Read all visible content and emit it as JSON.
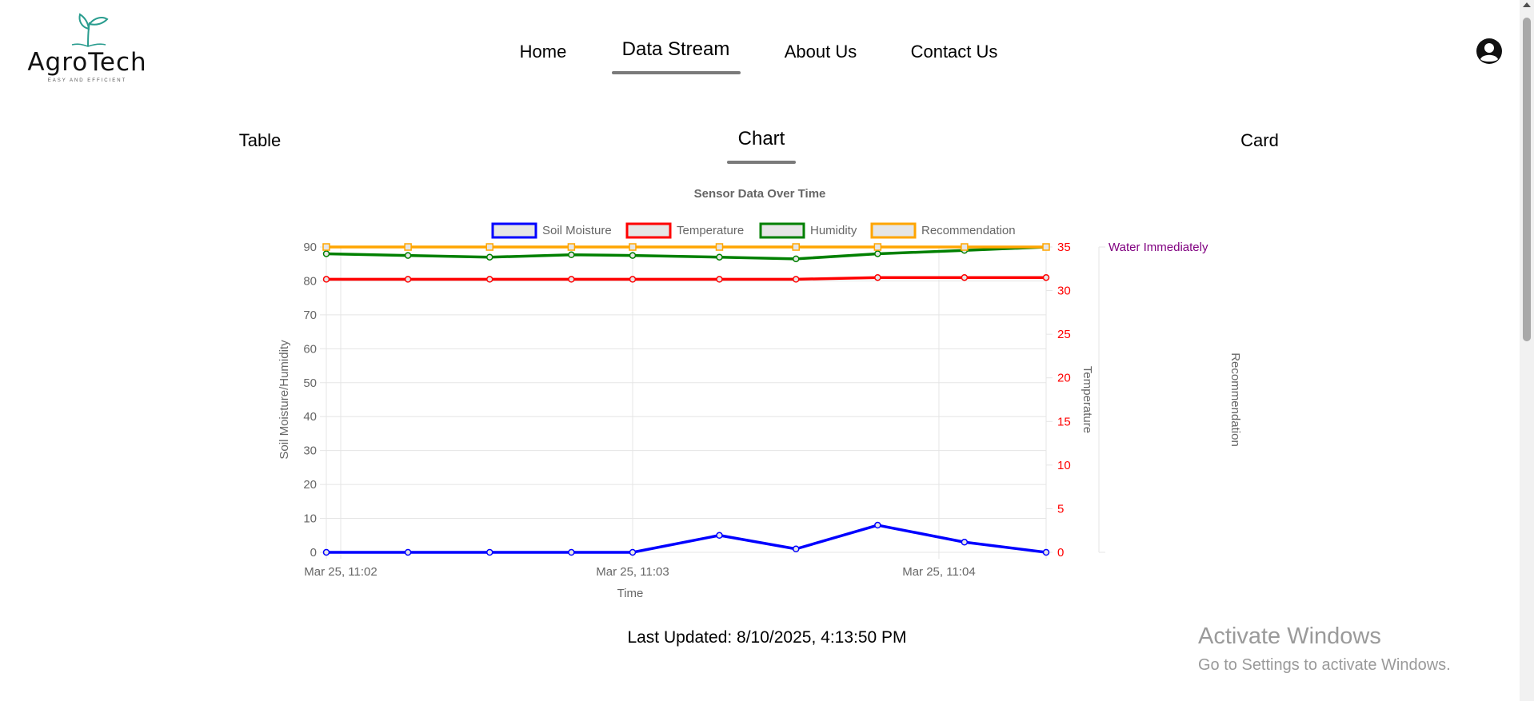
{
  "brand": {
    "name": "AgroTech",
    "tagline": "EASY AND EFFICIENT"
  },
  "nav": {
    "items": [
      {
        "label": "Home",
        "active": false
      },
      {
        "label": "Data Stream",
        "active": true
      },
      {
        "label": "About Us",
        "active": false
      },
      {
        "label": "Contact Us",
        "active": false
      }
    ]
  },
  "user": {
    "icon": "user-circle-icon"
  },
  "subtabs": [
    {
      "label": "Table",
      "active": false
    },
    {
      "label": "Chart",
      "active": true
    },
    {
      "label": "Card",
      "active": false
    }
  ],
  "chart_data": {
    "type": "line",
    "title": "Sensor Data Over Time",
    "xlabel": "Time",
    "x_ticks": [
      "Mar 25, 11:02",
      "Mar 25, 11:03",
      "Mar 25, 11:04"
    ],
    "y_left": {
      "label": "Soil Moisture/Humidity",
      "lim": [
        0,
        90
      ],
      "ticks": [
        0,
        10,
        20,
        30,
        40,
        50,
        60,
        70,
        80,
        90
      ]
    },
    "y_right": {
      "label": "Temperature",
      "lim": [
        0,
        35
      ],
      "ticks": [
        0,
        5,
        10,
        15,
        20,
        25,
        30,
        35
      ],
      "color": "#ff0000"
    },
    "y_recommendation": {
      "label": "Recommendation",
      "tick": "Water Immediately",
      "color": "#800080"
    },
    "x_times": [
      "11:02:00",
      "11:02:16",
      "11:02:32",
      "11:02:48",
      "11:03:00",
      "11:03:17",
      "11:03:32",
      "11:03:48",
      "11:04:05",
      "11:04:21"
    ],
    "series": [
      {
        "name": "Soil Moisture",
        "color": "#0000ff",
        "axis": "left",
        "marker": "circle",
        "values": [
          0,
          0,
          0,
          0,
          0,
          5,
          1,
          8,
          3,
          0
        ]
      },
      {
        "name": "Temperature",
        "color": "#ff0000",
        "axis": "right",
        "marker": "circle",
        "values": [
          31.3,
          31.3,
          31.3,
          31.3,
          31.3,
          31.3,
          31.3,
          31.5,
          31.5,
          31.5
        ]
      },
      {
        "name": "Humidity",
        "color": "#008000",
        "axis": "left",
        "marker": "circle",
        "values": [
          88,
          87.5,
          87,
          87.7,
          87.5,
          87,
          86.5,
          88,
          89,
          90
        ]
      },
      {
        "name": "Recommendation",
        "color": "#ffa500",
        "axis": "recommendation",
        "marker": "square",
        "values": [
          "Water Immediately",
          "Water Immediately",
          "Water Immediately",
          "Water Immediately",
          "Water Immediately",
          "Water Immediately",
          "Water Immediately",
          "Water Immediately",
          "Water Immediately",
          "Water Immediately"
        ]
      }
    ],
    "legend_position": "top",
    "grid": true
  },
  "status": {
    "last_updated": "Last Updated: 8/10/2025, 4:13:50 PM"
  },
  "watermark": {
    "title": "Activate Windows",
    "subtitle": "Go to Settings to activate Windows."
  }
}
